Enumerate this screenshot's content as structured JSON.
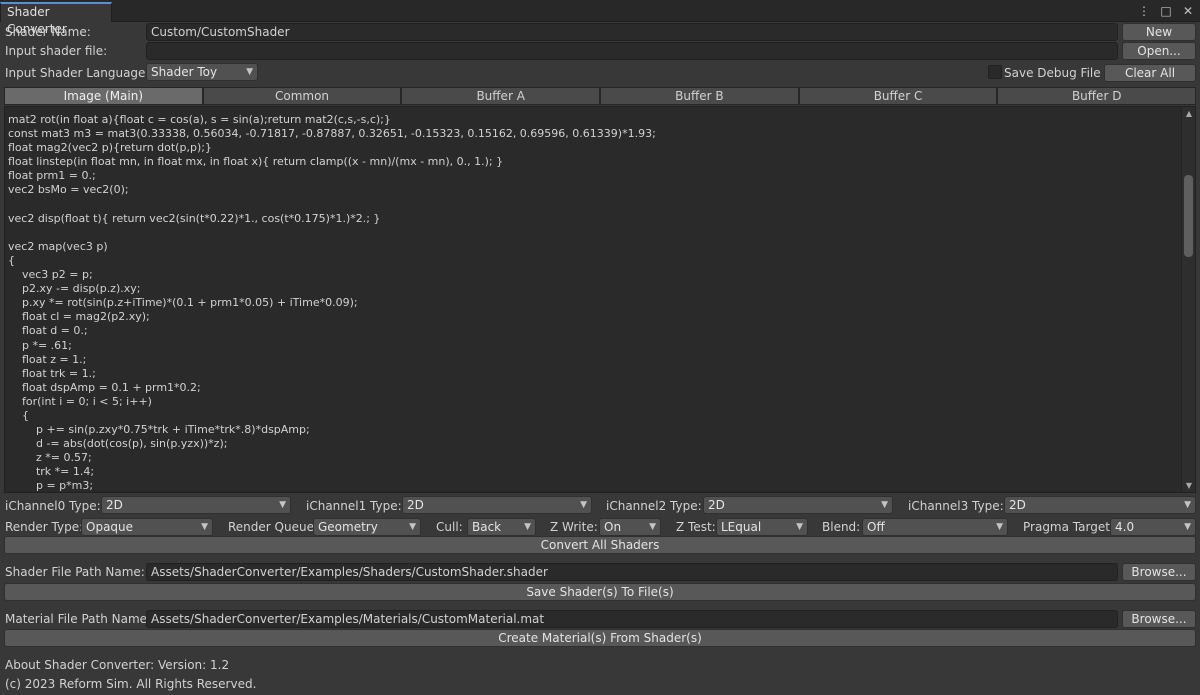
{
  "window": {
    "tab_title": "Shader Converter",
    "icons": [
      "more-vertical-icon",
      "maximize-icon",
      "close-icon"
    ],
    "icon_glyphs": [
      "⋮",
      "□",
      "✕"
    ]
  },
  "shader_name": {
    "label": "Shader Name:",
    "value": "Custom/CustomShader",
    "button": "New"
  },
  "input_file": {
    "label": "Input shader file:",
    "value": "",
    "button": "Open..."
  },
  "language": {
    "label": "Input Shader Language:",
    "selected": "Shader Toy",
    "save_debug_label": "Save Debug File",
    "save_debug_checked": false,
    "clear_all": "Clear All"
  },
  "tabs": [
    "Image (Main)",
    "Common",
    "Buffer A",
    "Buffer B",
    "Buffer C",
    "Buffer D"
  ],
  "active_tab": 0,
  "code_lines": [
    "mat2 rot(in float a){float c = cos(a), s = sin(a);return mat2(c,s,-s,c);}",
    "const mat3 m3 = mat3(0.33338, 0.56034, -0.71817, -0.87887, 0.32651, -0.15323, 0.15162, 0.69596, 0.61339)*1.93;",
    "float mag2(vec2 p){return dot(p,p);}",
    "float linstep(in float mn, in float mx, in float x){ return clamp((x - mn)/(mx - mn), 0., 1.); }",
    "float prm1 = 0.;",
    "vec2 bsMo = vec2(0);",
    "",
    "vec2 disp(float t){ return vec2(sin(t*0.22)*1., cos(t*0.175)*1.)*2.; }",
    "",
    "vec2 map(vec3 p)",
    "{",
    "    vec3 p2 = p;",
    "    p2.xy -= disp(p.z).xy;",
    "    p.xy *= rot(sin(p.z+iTime)*(0.1 + prm1*0.05) + iTime*0.09);",
    "    float cl = mag2(p2.xy);",
    "    float d = 0.;",
    "    p *= .61;",
    "    float z = 1.;",
    "    float trk = 1.;",
    "    float dspAmp = 0.1 + prm1*0.2;",
    "    for(int i = 0; i < 5; i++)",
    "    {",
    "        p += sin(p.zxy*0.75*trk + iTime*trk*.8)*dspAmp;",
    "        d -= abs(dot(cos(p), sin(p.yzx))*z);",
    "        z *= 0.57;",
    "        trk *= 1.4;",
    "        p = p*m3;"
  ],
  "channels": [
    {
      "label": "iChannel0 Type:",
      "value": "2D"
    },
    {
      "label": "iChannel1 Type:",
      "value": "2D"
    },
    {
      "label": "iChannel2 Type:",
      "value": "2D"
    },
    {
      "label": "iChannel3 Type:",
      "value": "2D"
    }
  ],
  "render": {
    "render_type": {
      "label": "Render Type:",
      "value": "Opaque"
    },
    "render_queue": {
      "label": "Render Queue:",
      "value": "Geometry"
    },
    "cull": {
      "label": "Cull:",
      "value": "Back"
    },
    "z_write": {
      "label": "Z Write:",
      "value": "On"
    },
    "z_test": {
      "label": "Z Test:",
      "value": "LEqual"
    },
    "blend": {
      "label": "Blend:",
      "value": "Off"
    },
    "pragma": {
      "label": "Pragma Target:",
      "value": "4.0"
    }
  },
  "convert_all": "Convert All Shaders",
  "shader_path": {
    "label": "Shader File Path Name:",
    "value": "Assets/ShaderConverter/Examples/Shaders/CustomShader.shader",
    "button": "Browse..."
  },
  "save_shader": "Save Shader(s) To File(s)",
  "material_path": {
    "label": "Material File Path Name:",
    "value": "Assets/ShaderConverter/Examples/Materials/CustomMaterial.mat",
    "button": "Browse..."
  },
  "create_material": "Create Material(s) From Shader(s)",
  "about": "About Shader Converter: Version: 1.2",
  "copyright": "(c) 2023 Reform Sim. All Rights Reserved."
}
